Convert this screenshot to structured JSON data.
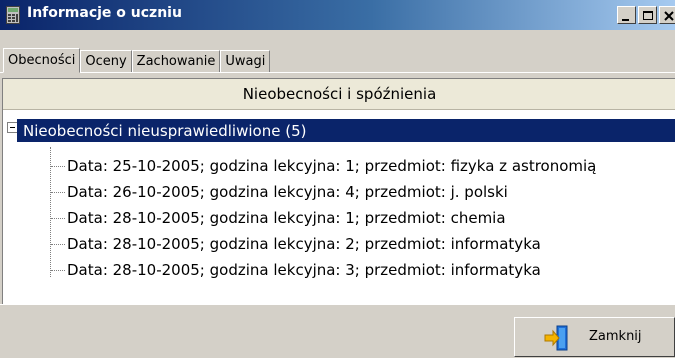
{
  "window": {
    "title": "Informacje o uczniu",
    "icon": "calculator-icon",
    "buttons": [
      "minimize-icon",
      "maximize-icon",
      "close-icon"
    ]
  },
  "tabs": [
    {
      "label": "Obecności",
      "active": true
    },
    {
      "label": "Oceny",
      "active": false
    },
    {
      "label": "Zachowanie",
      "active": false
    },
    {
      "label": "Uwagi",
      "active": false
    }
  ],
  "section": {
    "header": "Nieobecności i spóźnienia"
  },
  "tree": {
    "root_label": "Nieobecności nieusprawiedliwione (5)",
    "items": [
      "Data: 25-10-2005; godzina lekcyjna: 1; przedmiot: fizyka z astronomią",
      "Data: 26-10-2005; godzina lekcyjna: 4; przedmiot: j. polski",
      "Data: 28-10-2005; godzina lekcyjna: 1; przedmiot: chemia",
      "Data: 28-10-2005; godzina lekcyjna: 2; przedmiot: informatyka",
      "Data: 28-10-2005; godzina lekcyjna: 3; przedmiot: informatyka"
    ]
  },
  "footer": {
    "close_label": "Zamknij",
    "close_icon": "exit-door-icon"
  },
  "colors": {
    "titlebar": "#0a246a",
    "selection": "#0a246a",
    "face": "#d4d0c8",
    "header": "#ece9d8"
  }
}
